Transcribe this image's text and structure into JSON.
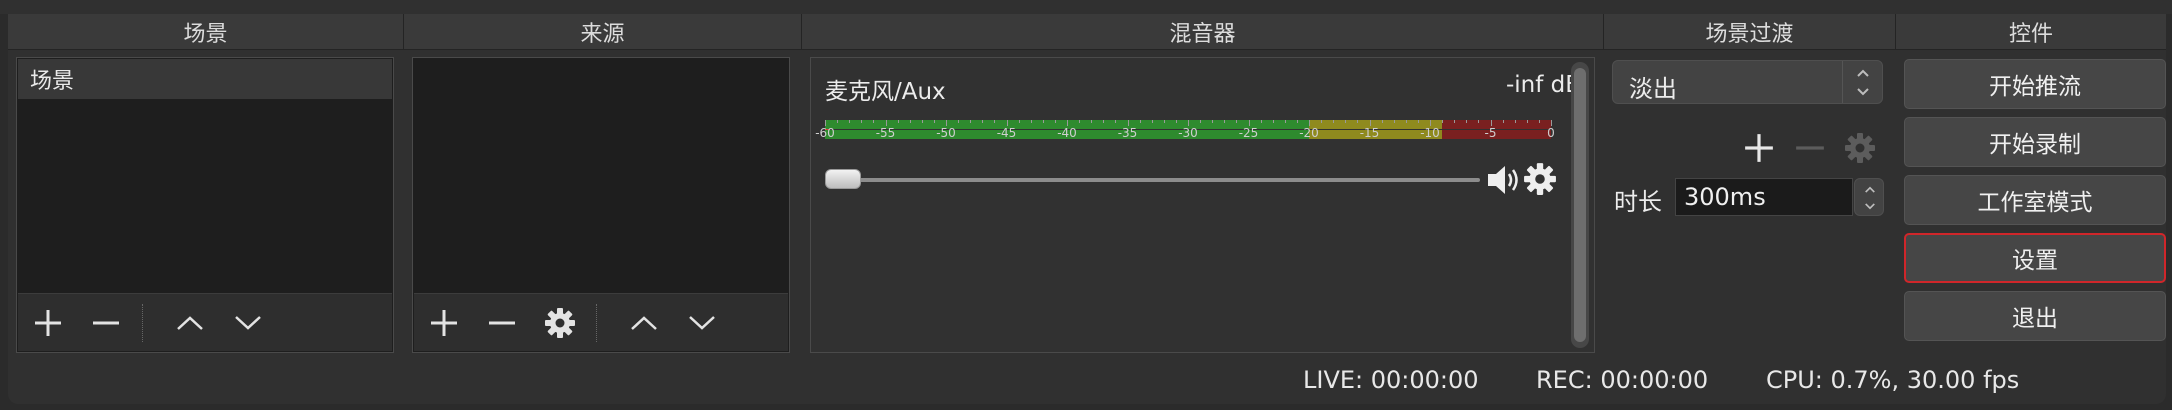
{
  "columns": {
    "scenes": "场景",
    "sources": "来源",
    "mixer": "混音器",
    "transitions": "场景过渡",
    "controls": "控件"
  },
  "scenes": {
    "items": [
      "场景"
    ]
  },
  "mixer": {
    "track_name": "麦克风/Aux",
    "level": "-inf dB",
    "tick_labels": [
      "-60",
      "-55",
      "-50",
      "-45",
      "-40",
      "-35",
      "-30",
      "-25",
      "-20",
      "-15",
      "-10",
      "-5",
      "0"
    ],
    "volume": 0.0,
    "colors": {
      "green": "#2e8b2e",
      "yellow": "#8f8a1e",
      "red": "#7a2020"
    }
  },
  "transitions": {
    "selected": "淡出",
    "duration_label": "时长",
    "duration_value": "300ms"
  },
  "controls": {
    "start_streaming": "开始推流",
    "start_recording": "开始录制",
    "studio_mode": "工作室模式",
    "settings": "设置",
    "exit": "退出"
  },
  "status": {
    "live": "LIVE: 00:00:00",
    "rec": "REC: 00:00:00",
    "cpu": "CPU: 0.7%, 30.00 fps"
  },
  "accent_color": "#d0262a"
}
